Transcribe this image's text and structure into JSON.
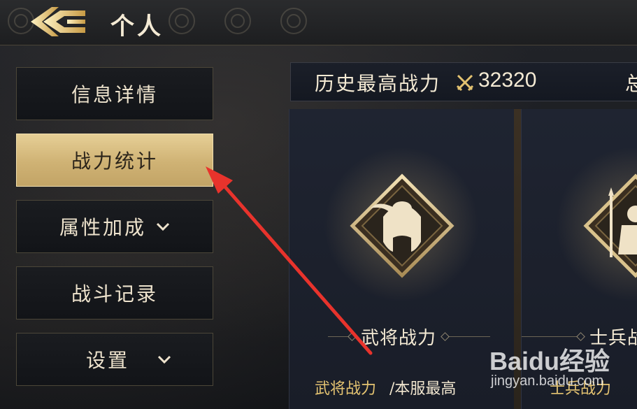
{
  "header": {
    "title": "个人",
    "back_icon": "gold-back-arrow-icon"
  },
  "sidebar": {
    "items": [
      {
        "label": "信息详情",
        "active": false
      },
      {
        "label": "战力统计",
        "active": true
      },
      {
        "label": "属性加成",
        "active": false,
        "has_dropdown": true
      },
      {
        "label": "战斗记录",
        "active": false
      },
      {
        "label": "设置",
        "active": false,
        "has_dropdown": true
      }
    ]
  },
  "stats": {
    "highest_power_label": "历史最高战力",
    "highest_power_value": "32320",
    "next_label_partial": "总",
    "icon": "crossed-swords-icon"
  },
  "cards": [
    {
      "label": "武将战力",
      "icon": "general-helmet-emblem-icon"
    },
    {
      "label": "士兵战力",
      "icon": "soldier-emblem-icon"
    }
  ],
  "footer": {
    "general_power_label": "武将战力",
    "server_highest": "/本服最高",
    "soldier_power_label": "士兵战力"
  },
  "watermark": {
    "brand": "Baidu经验",
    "url": "jingyan.baidu.com"
  },
  "colors": {
    "accent_gold": "#e4c371",
    "active_tab": "#d9be82",
    "annotation_arrow": "#e8332c"
  }
}
